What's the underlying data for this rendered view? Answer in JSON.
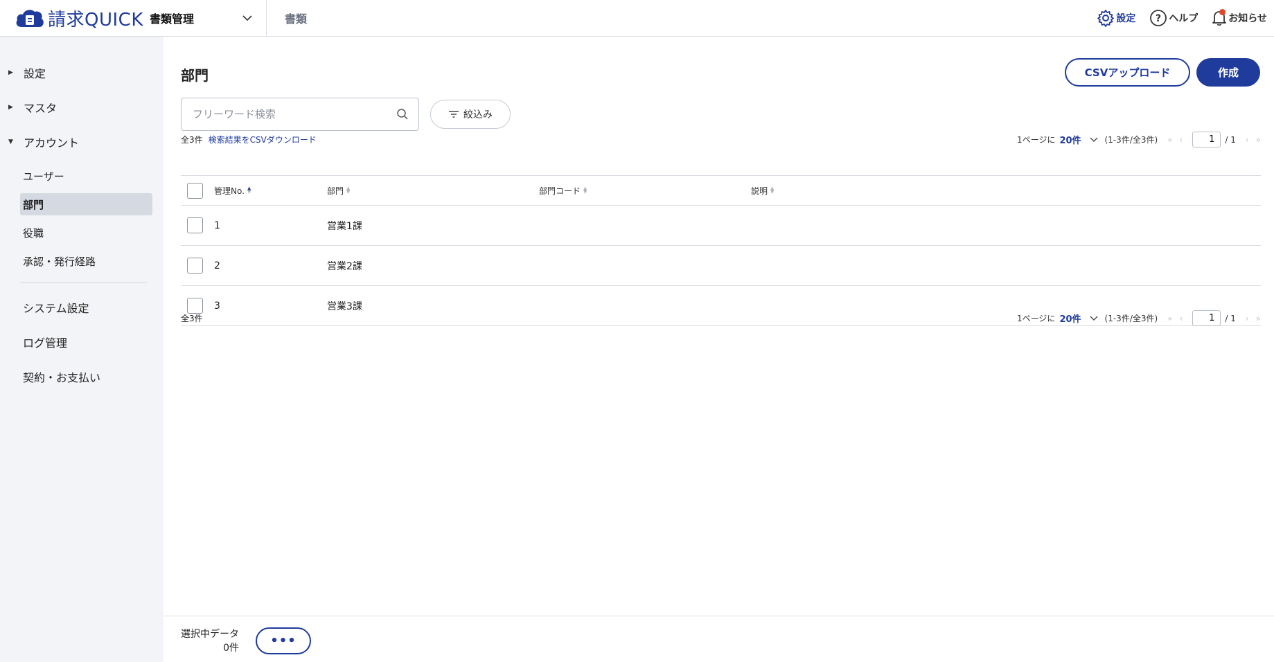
{
  "app": {
    "logo_text": "請求QUICK",
    "module_selector": "書類管理",
    "doc_link": "書類",
    "settings_label": "設定",
    "help_label": "ヘルプ",
    "notice_label": "お知らせ"
  },
  "sidebar": {
    "groups": [
      {
        "label": "設定",
        "expanded": false
      },
      {
        "label": "マスタ",
        "expanded": false
      },
      {
        "label": "アカウント",
        "expanded": true
      }
    ],
    "account_items": [
      {
        "label": "ユーザー"
      },
      {
        "label": "部門",
        "active": true
      },
      {
        "label": "役職"
      },
      {
        "label": "承認・発行経路"
      }
    ],
    "plain_items": [
      {
        "label": "システム設定"
      },
      {
        "label": "ログ管理"
      },
      {
        "label": "契約・お支払い"
      }
    ]
  },
  "main": {
    "title": "部門",
    "csv_upload_label": "CSVアップロード",
    "create_label": "作成",
    "search_placeholder": "フリーワード検索",
    "filter_label": "絞込み",
    "total_text": "全3件",
    "csv_download_label": "検索結果をCSVダウンロード",
    "pager": {
      "per_page_prefix": "1ページに",
      "per_page_value": "20件",
      "range_text": "(1-3件/全3件)",
      "current_page": "1",
      "total_pages": "/ 1"
    },
    "columns": [
      "管理No.",
      "部門",
      "部門コード",
      "説明"
    ],
    "rows": [
      {
        "no": "1",
        "dept": "営業1課",
        "code": "",
        "desc": ""
      },
      {
        "no": "2",
        "dept": "営業2課",
        "code": "",
        "desc": ""
      },
      {
        "no": "3",
        "dept": "営業3課",
        "code": "",
        "desc": ""
      }
    ],
    "footer_total_text": "全3件"
  },
  "footer": {
    "selected_label": "選択中データ",
    "selected_count": "0件",
    "more_label": "•••"
  },
  "colors": {
    "accent": "#1f3b9c",
    "sidebar_bg": "#f3f4f7",
    "notice_dot": "#e0462a"
  }
}
